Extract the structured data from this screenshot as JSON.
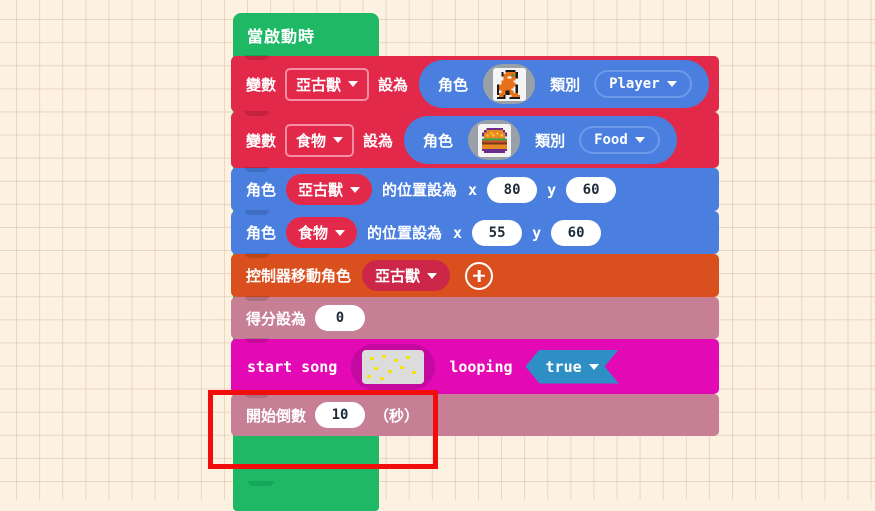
{
  "workspace": {
    "background_color": "#fdf2e2",
    "grid_color": "#c9a884"
  },
  "script": {
    "hat": {
      "label": "當啟動時",
      "color": "#1fb966"
    },
    "blocks": [
      {
        "kind": "variable-set-sprite",
        "color": "#e2294a",
        "label_prefix": "變數",
        "variable": "亞古獸",
        "label_middle": "設為",
        "inner": {
          "color": "#4a7fe0",
          "label_role": "角色",
          "sprite_icon": "agumon-sprite-icon",
          "label_category": "類別",
          "category": "Player"
        }
      },
      {
        "kind": "variable-set-sprite",
        "color": "#e2294a",
        "label_prefix": "變數",
        "variable": "食物",
        "label_middle": "設為",
        "inner": {
          "color": "#4a7fe0",
          "label_role": "角色",
          "sprite_icon": "burger-sprite-icon",
          "label_category": "類別",
          "category": "Food"
        }
      },
      {
        "kind": "set-position",
        "color": "#4a7fe0",
        "label_prefix": "角色",
        "sprite": "亞古獸",
        "label_middle": "的位置設為",
        "x_label": "x",
        "x_value": "80",
        "y_label": "y",
        "y_value": "60"
      },
      {
        "kind": "set-position",
        "color": "#4a7fe0",
        "label_prefix": "角色",
        "sprite": "食物",
        "label_middle": "的位置設為",
        "x_label": "x",
        "x_value": "55",
        "y_label": "y",
        "y_value": "60"
      },
      {
        "kind": "controller-move",
        "color": "#d9501e",
        "label_prefix": "控制器移動角色",
        "sprite": "亞古獸",
        "add_icon": "plus-circle-icon"
      },
      {
        "kind": "set-score",
        "color": "#c67f94",
        "label_prefix": "得分設為",
        "value": "0"
      },
      {
        "kind": "start-song",
        "color": "#e309b4",
        "label_prefix": "start song",
        "song_icon": "music-pattern-icon",
        "label_middle": "looping",
        "looping": "true"
      },
      {
        "kind": "start-countdown",
        "color": "#c67f94",
        "label_prefix": "開始倒數",
        "value": "10",
        "label_suffix": "（秒）"
      }
    ]
  },
  "annotation": {
    "color": "#f20d0d",
    "target": "start-countdown-block"
  }
}
